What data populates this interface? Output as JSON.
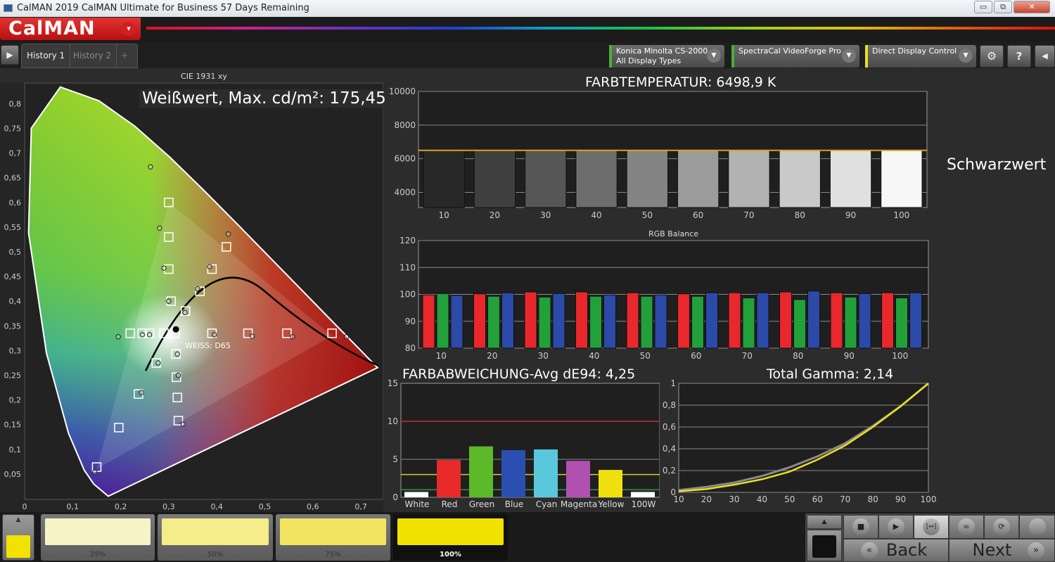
{
  "window": {
    "title": "CalMAN 2019 CalMAN Ultimate for Business 57 Days Remaining",
    "min": "▭",
    "restore": "⧉",
    "close": "✕"
  },
  "logo": {
    "text": "CalMAN",
    "caret": "▾"
  },
  "tabs": [
    {
      "label": "History 1",
      "active": true
    },
    {
      "label": "History 2",
      "active": false
    },
    {
      "label": "+",
      "active": false
    }
  ],
  "devices": [
    {
      "line1": "Konica Minolta CS-2000",
      "line2": "All Display Types",
      "color": "#4caf3a"
    },
    {
      "line1": "SpectraCal VideoForge Pro",
      "line2": "",
      "color": "#4caf3a"
    },
    {
      "line1": "Direct Display Control",
      "line2": "",
      "color": "#e8e020"
    }
  ],
  "toolbar_icons": {
    "settings": "⚙",
    "help": "?",
    "collapse": "◀",
    "expand": "▶"
  },
  "cie": {
    "title": "CIE 1931 xy",
    "white_label": "Weißwert, Max. cd/m²: 175,45"
  },
  "black_label": "Schwarzwert",
  "colortemp": {
    "title": "FARBTEMPERATUR: 6498,9 K"
  },
  "rgb": {
    "title": "RGB Balance"
  },
  "de": {
    "title": "FARBABWEICHUNG-Avg dE94: 4,25"
  },
  "gamma": {
    "title": "Total Gamma: 2,14"
  },
  "chart_data": [
    {
      "type": "scatter",
      "title": "CIE 1931 xy",
      "xlim": [
        0,
        0.75
      ],
      "ylim": [
        0,
        0.85
      ],
      "xticks": [
        "0",
        "0,1",
        "0,2",
        "0,3",
        "0,4",
        "0,5",
        "0,6",
        "0,7"
      ],
      "yticks": [
        "0,05",
        "0,1",
        "0,15",
        "0,2",
        "0,25",
        "0,3",
        "0,35",
        "0,4",
        "0,45",
        "0,5",
        "0,55",
        "0,6",
        "0,65",
        "0,7",
        "0,75",
        "0,8"
      ],
      "targets": [
        [
          0.3,
          0.6
        ],
        [
          0.3,
          0.53
        ],
        [
          0.3,
          0.465
        ],
        [
          0.305,
          0.4
        ],
        [
          0.42,
          0.51
        ],
        [
          0.39,
          0.465
        ],
        [
          0.365,
          0.42
        ],
        [
          0.335,
          0.38
        ],
        [
          0.22,
          0.335
        ],
        [
          0.245,
          0.335
        ],
        [
          0.26,
          0.335
        ],
        [
          0.29,
          0.335
        ],
        [
          0.313,
          0.335
        ],
        [
          0.39,
          0.335
        ],
        [
          0.465,
          0.335
        ],
        [
          0.546,
          0.335
        ],
        [
          0.64,
          0.335
        ],
        [
          0.15,
          0.064
        ],
        [
          0.196,
          0.144
        ],
        [
          0.237,
          0.212
        ],
        [
          0.274,
          0.275
        ],
        [
          0.32,
          0.158
        ],
        [
          0.318,
          0.205
        ],
        [
          0.316,
          0.246
        ],
        [
          0.315,
          0.293
        ]
      ],
      "measured": [
        [
          0.262,
          0.672
        ],
        [
          0.281,
          0.548
        ],
        [
          0.29,
          0.467
        ],
        [
          0.3,
          0.4
        ],
        [
          0.334,
          0.377
        ],
        [
          0.36,
          0.425
        ],
        [
          0.385,
          0.47
        ],
        [
          0.424,
          0.536
        ],
        [
          0.395,
          0.332
        ],
        [
          0.474,
          0.329
        ],
        [
          0.558,
          0.328
        ],
        [
          0.67,
          0.328
        ],
        [
          0.195,
          0.328
        ],
        [
          0.26,
          0.332
        ],
        [
          0.146,
          0.054
        ],
        [
          0.243,
          0.215
        ],
        [
          0.278,
          0.275
        ],
        [
          0.33,
          0.151
        ],
        [
          0.32,
          0.25
        ],
        [
          0.318,
          0.293
        ],
        [
          0.245,
          0.332
        ]
      ],
      "white_point": {
        "x": 0.315,
        "y": 0.343,
        "label": "WEISS: D65"
      }
    },
    {
      "type": "bar",
      "title": "FARBTEMPERATUR: 6498,9 K",
      "categories": [
        "10",
        "20",
        "30",
        "40",
        "50",
        "60",
        "70",
        "80",
        "90",
        "100"
      ],
      "values": [
        6480,
        6500,
        6490,
        6490,
        6500,
        6495,
        6500,
        6500,
        6500,
        6500
      ],
      "target": 6500,
      "ylim": [
        3100,
        10000
      ],
      "yticks": [
        "4000",
        "6000",
        "8000",
        "10000"
      ]
    },
    {
      "type": "bar",
      "title": "RGB Balance",
      "categories": [
        "10",
        "20",
        "30",
        "40",
        "50",
        "60",
        "70",
        "80",
        "90",
        "100"
      ],
      "ylim": [
        80,
        120
      ],
      "yticks": [
        "80",
        "90",
        "100",
        "110",
        "120"
      ],
      "series": [
        {
          "color": "#e8282c",
          "values": [
            99.8,
            100.2,
            100.9,
            100.9,
            100.6,
            100.2,
            100.6,
            100.9,
            100.6,
            100.6
          ]
        },
        {
          "color": "#22a03a",
          "values": [
            100.3,
            99.3,
            99.0,
            99.3,
            99.3,
            99.3,
            98.7,
            98.1,
            99.0,
            98.7
          ]
        },
        {
          "color": "#2c4aa8",
          "values": [
            99.6,
            100.6,
            100.3,
            99.8,
            99.8,
            100.6,
            100.6,
            101.2,
            100.3,
            100.6
          ]
        }
      ]
    },
    {
      "type": "bar",
      "title": "FARBABWEICHUNG-Avg dE94: 4,25",
      "categories": [
        "White",
        "Red",
        "Green",
        "Blue",
        "Cyan",
        "Magenta",
        "Yellow",
        "100W"
      ],
      "values": [
        0.7,
        4.9,
        6.7,
        6.2,
        6.3,
        4.8,
        3.6,
        0.7
      ],
      "colors": [
        "#ffffff",
        "#e82a2a",
        "#5cba2a",
        "#2a4fb0",
        "#5ac8dc",
        "#b050b0",
        "#f0e010",
        "#ffffff"
      ],
      "ylim": [
        0,
        15
      ],
      "yticks": [
        "0",
        "5",
        "10",
        "15"
      ],
      "thresholds": [
        {
          "value": 10,
          "color": "#c03030"
        },
        {
          "value": 3,
          "color": "#d8d020"
        },
        {
          "value": 1,
          "color": "#2a9a3a"
        }
      ]
    },
    {
      "type": "line",
      "title": "Total Gamma: 2,14",
      "x": [
        10,
        20,
        30,
        40,
        50,
        60,
        70,
        80,
        90,
        100
      ],
      "xlim": [
        10,
        100
      ],
      "ylim": [
        0,
        1
      ],
      "yticks": [
        "0",
        "0,2",
        "0,4",
        "0,6",
        "0,8",
        "1"
      ],
      "series": [
        {
          "color": "#8a8a8a",
          "values": [
            0.02,
            0.05,
            0.09,
            0.15,
            0.23,
            0.33,
            0.45,
            0.61,
            0.79,
            1.0
          ]
        },
        {
          "color": "#e8e020",
          "values": [
            0.01,
            0.03,
            0.07,
            0.12,
            0.19,
            0.3,
            0.43,
            0.6,
            0.79,
            1.0
          ]
        }
      ]
    }
  ],
  "swatch": {
    "current_color": "#f2e200",
    "up": "▲",
    "cards": [
      {
        "label": "25%",
        "color": "#f7f3c8"
      },
      {
        "label": "50%",
        "color": "#f5ec8a"
      },
      {
        "label": "75%",
        "color": "#f2e460"
      },
      {
        "label": "100%",
        "color": "#f2e200",
        "active": true
      }
    ]
  },
  "controls": {
    "up": "▲",
    "stop": "■",
    "play": "▶",
    "fit": "[↔]",
    "loop": "∞",
    "refresh": "⟳",
    "blank": "",
    "back": "Back",
    "next": "Next",
    "back_icon": "«",
    "next_icon": "»"
  }
}
